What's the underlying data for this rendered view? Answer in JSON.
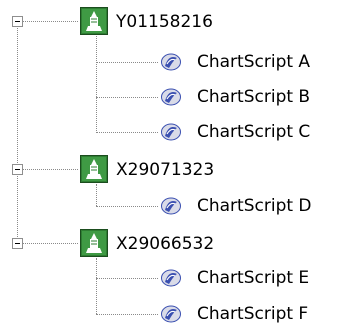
{
  "tree": {
    "nodes": [
      {
        "label": "Y01158216",
        "expanded": true,
        "icon": "green-node-icon",
        "children": [
          {
            "label": "ChartScript A",
            "icon": "chartscript-icon"
          },
          {
            "label": "ChartScript B",
            "icon": "chartscript-icon"
          },
          {
            "label": "ChartScript C",
            "icon": "chartscript-icon"
          }
        ]
      },
      {
        "label": "X29071323",
        "expanded": true,
        "icon": "green-node-icon",
        "children": [
          {
            "label": "ChartScript D",
            "icon": "chartscript-icon"
          }
        ]
      },
      {
        "label": "X29066532",
        "expanded": true,
        "icon": "green-node-icon",
        "children": [
          {
            "label": "ChartScript E",
            "icon": "chartscript-icon"
          },
          {
            "label": "ChartScript F",
            "icon": "chartscript-icon"
          }
        ]
      }
    ],
    "colors": {
      "node_icon_green": "#2e7d32",
      "line": "#8a8a8a",
      "leaf_blue": "#3a4fb0"
    }
  }
}
